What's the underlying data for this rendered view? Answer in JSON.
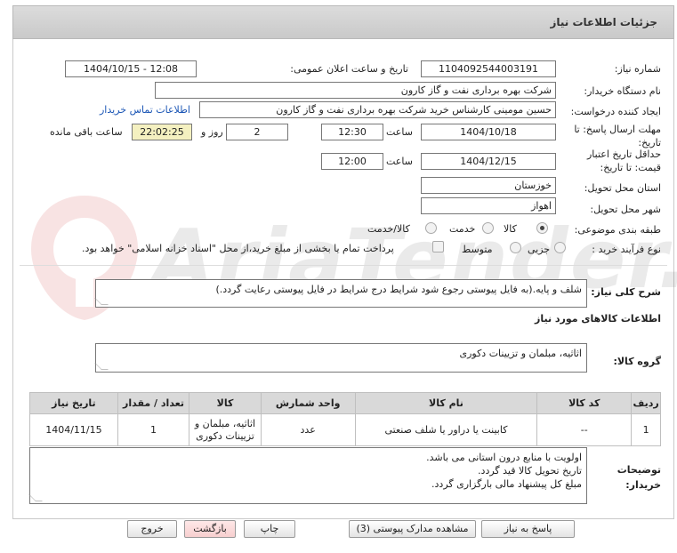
{
  "header": {
    "title": "جزئیات اطلاعات نیاز"
  },
  "watermark": {
    "text": "AriaTender.neT"
  },
  "labels": {
    "need_number": "شماره نیاز:",
    "announce_datetime": "تاریخ و ساعت اعلان عمومی:",
    "buyer_org": "نام دستگاه خریدار:",
    "requester": "ایجاد کننده درخواست:",
    "send_deadline": "مهلت ارسال پاسخ: تا تاریخ:",
    "time": "ساعت",
    "day_and": "روز و",
    "remaining": "ساعت باقی مانده",
    "price_validity": "حداقل تاریخ اعتبار قیمت: تا تاریخ:",
    "time2": "ساعت",
    "delivery_province": "استان محل تحویل:",
    "delivery_city": "شهر محل تحویل:",
    "subject_class": "طبقه بندی موضوعی:",
    "purchase_type": "نوع فرآیند خرید :",
    "general_desc": "شرح کلی نیاز:",
    "goods_info": "اطلاعات کالاهای مورد نیاز",
    "goods_group": "گروه کالا:",
    "buyer_notes": "توضیحات خریدار:"
  },
  "values": {
    "need_number": "1104092544003191",
    "announce_datetime": "1404/10/15 - 12:08",
    "buyer_org": "شرکت بهره برداری نفت و گاز کارون",
    "requester": "حسین مومینی کارشناس خرید شرکت بهره برداری نفت و گاز کارون",
    "contact_link": "اطلاعات تماس خریدار",
    "send_date": "1404/10/18",
    "send_time": "12:30",
    "days": "2",
    "remaining_time": "22:02:25",
    "validity_date": "1404/12/15",
    "validity_time": "12:00",
    "province": "خوزستان",
    "city": "اهواز"
  },
  "subject_options": [
    {
      "label": "کالا",
      "selected": true
    },
    {
      "label": "خدمت",
      "selected": false
    },
    {
      "label": "کالا/خدمت",
      "selected": false
    }
  ],
  "purchase_options": [
    {
      "label": "جزیی",
      "selected": false
    },
    {
      "label": "متوسط",
      "selected": false
    }
  ],
  "payment_note": "پرداخت تمام یا بخشی از مبلغ خرید،از محل \"اسناد خزانه اسلامی\" خواهد بود.",
  "general_desc": "شلف و پایه.(به فایل پیوستی رجوع شود شرایط درج شرایط در فایل پیوستی رعایت گردد.)",
  "goods_group": "اثاثیه، مبلمان و تزیینات دکوری",
  "table": {
    "headers": [
      "ردیف",
      "کد کالا",
      "نام کالا",
      "واحد شمارش",
      "تعداد / مقدار",
      "تاریخ نیاز"
    ],
    "rows": [
      [
        "1",
        "--",
        "کابینت یا دراور یا شلف صنعتی",
        "عدد",
        "1",
        "1404/11/15"
      ]
    ],
    "group_cell": "اثاثیه، مبلمان و تزیینات دکوری"
  },
  "notes": [
    "اولویت با منابع درون استانی می باشد.",
    "تاریخ تحویل کالا قید گردد.",
    "مبلغ کل پیشنهاد مالی بارگزاری گردد."
  ],
  "buttons": {
    "reply": "پاسخ به نیاز",
    "attachments": "مشاهده مدارک پیوستی (3)",
    "print": "چاپ",
    "back": "بازگشت",
    "exit": "خروج"
  }
}
